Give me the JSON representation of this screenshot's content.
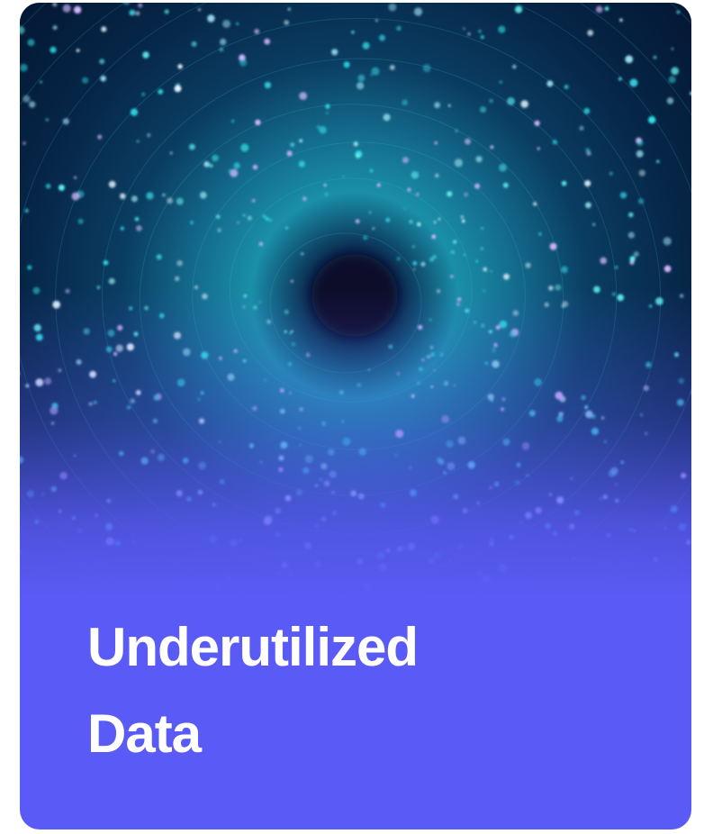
{
  "card": {
    "title_line_1": "Underutilized",
    "title_line_2": "Data",
    "image_icon": "data-vortex-illustration",
    "colors": {
      "accent": "#5a5bf6",
      "image_dark": "#041a36",
      "particle": "#28d6e0",
      "text": "#ffffff"
    }
  }
}
